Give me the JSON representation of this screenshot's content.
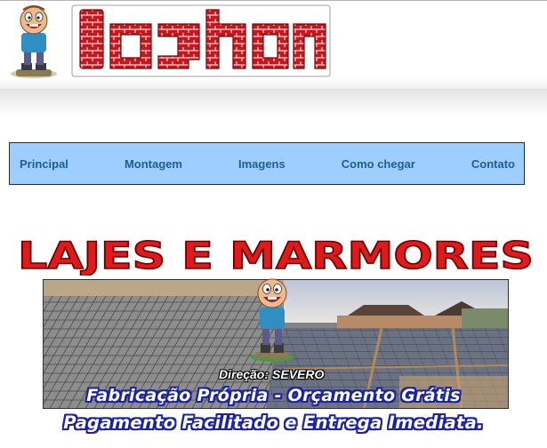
{
  "header": {
    "brand_name": "lojnon",
    "mascot_icon": "cartoon-mascot-icon"
  },
  "nav": {
    "items": [
      {
        "label": "Principal"
      },
      {
        "label": "Montagem"
      },
      {
        "label": "Imagens"
      },
      {
        "label": "Como chegar"
      },
      {
        "label": "Contato"
      }
    ]
  },
  "banner": {
    "title": "LAJES E MARMORES",
    "direcao_label": "Direção:",
    "direcao_name": "SEVERO",
    "slogan_line1": "Fabricação Própria - Orçamento Grátis",
    "slogan_line2": "Pagamento Facilitado e Entrega Imediata."
  },
  "colors": {
    "nav_bg": "#9ecdff",
    "nav_text": "#1d5f8f",
    "brand_red": "#c8161d",
    "slogan_outline": "#1a22a6"
  }
}
